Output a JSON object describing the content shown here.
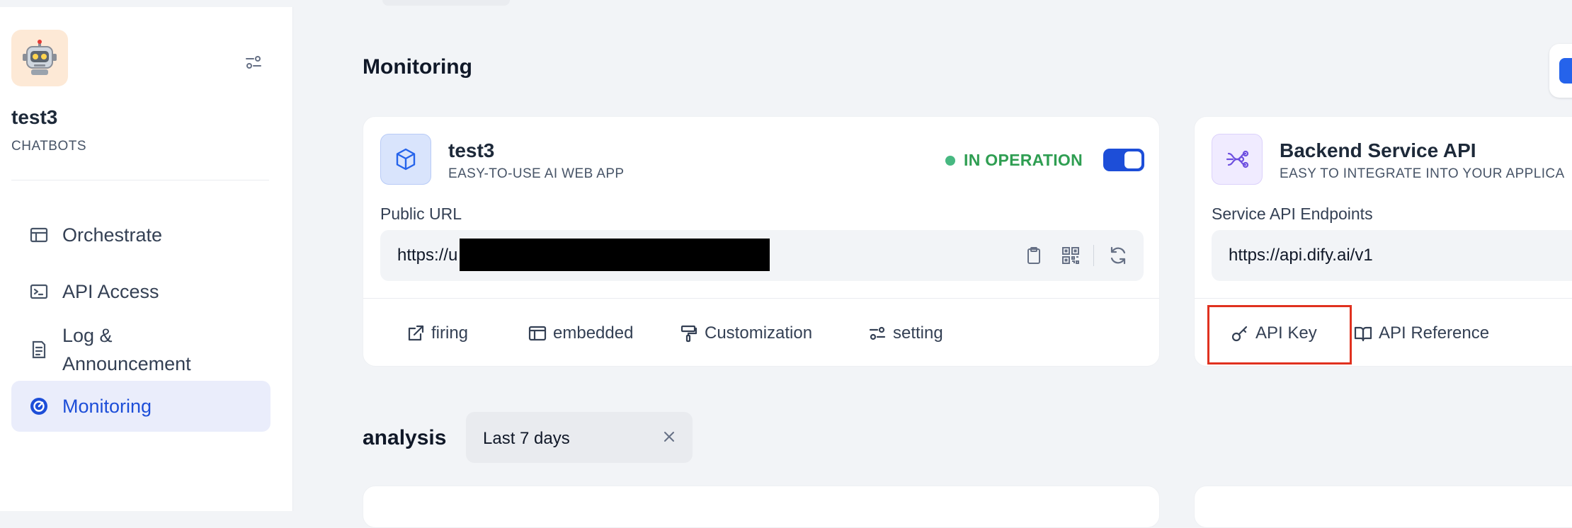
{
  "sidebar": {
    "app_name": "test3",
    "app_type": "CHATBOTS",
    "items": [
      {
        "label": "Orchestrate",
        "icon": "layout-icon"
      },
      {
        "label": "API Access",
        "icon": "terminal-icon"
      },
      {
        "label": "Log &\nAnnouncement",
        "icon": "file-list-icon"
      },
      {
        "label": "Monitoring",
        "icon": "dashboard-gauge-icon",
        "active": true
      }
    ]
  },
  "main": {
    "title": "Monitoring",
    "webapp_card": {
      "title": "test3",
      "subtitle": "EASY-TO-USE AI WEB APP",
      "status": "IN OPERATION",
      "enabled": true,
      "url_label": "Public URL",
      "url_value": "https://u",
      "actions": [
        {
          "label": "firing",
          "icon": "external-link-icon"
        },
        {
          "label": "embedded",
          "icon": "window-icon"
        },
        {
          "label": "Customization",
          "icon": "paint-roller-icon"
        },
        {
          "label": "setting",
          "icon": "sliders-icon"
        }
      ]
    },
    "api_card": {
      "title": "Backend Service API",
      "subtitle": "EASY TO INTEGRATE INTO YOUR APPLICA",
      "url_label": "Service API Endpoints",
      "url_value": "https://api.dify.ai/v1",
      "actions": [
        {
          "label": "API Key",
          "icon": "key-icon"
        },
        {
          "label": "API Reference",
          "icon": "book-open-icon"
        }
      ]
    },
    "analysis": {
      "title": "analysis",
      "range": "Last 7 days"
    }
  },
  "colors": {
    "accent": "#1d4ed8",
    "status_green": "#2f9e52",
    "highlight": "#e0311f"
  }
}
